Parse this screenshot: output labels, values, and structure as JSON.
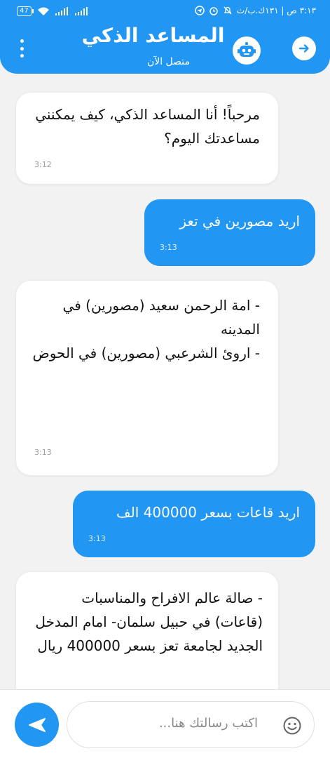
{
  "status_bar": {
    "battery": "47",
    "time": "٣:١٣ ص | ١٣١ك.ب/ث"
  },
  "header": {
    "title": "المساعد الذكي",
    "status": "متصل الآن"
  },
  "messages": [
    {
      "sender": "bot",
      "text": "مرحباً! أنا المساعد الذكي، كيف يمكنني مساعدتك اليوم؟",
      "time": "3:12"
    },
    {
      "sender": "user",
      "text": "اريد مصورين في تعز",
      "time": "3:13"
    },
    {
      "sender": "bot",
      "text": "- امة الرحمن سعيد  (مصورين) في المدينه\n- اروئ الشرعبي (مصورين) في الحوض",
      "time": "3:13"
    },
    {
      "sender": "user",
      "text": "اريد قاعات بسعر 400000 الف",
      "time": "3:13"
    },
    {
      "sender": "bot",
      "text": "- صالة عالم الافراح والمناسبات (قاعات) في حبيل سلمان- امام المدخل الجديد لجامعة تعز  بسعر 400000 ريال",
      "time": ""
    }
  ],
  "input": {
    "placeholder": "اكتب رسالتك هنا..."
  },
  "colors": {
    "accent": "#2196f3",
    "bot_bubble": "#ffffff",
    "background": "#f2f2f2"
  }
}
